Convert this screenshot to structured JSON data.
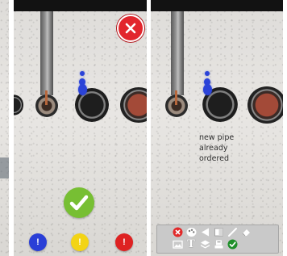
{
  "annotation": {
    "note_text": "new pipe\nalready\nordered"
  },
  "dots": [
    {
      "label": "!",
      "color": "#2a3fd7"
    },
    {
      "label": "!",
      "color": "#f3d415"
    },
    {
      "label": "!",
      "color": "#de2222"
    }
  ],
  "toolbar": {
    "text_tool_label": "T"
  },
  "colors": {
    "close_red": "#e2262d",
    "confirm_green": "#77bf33",
    "marker_blue": "#2b43d8",
    "toolbar_bg": "#c9c9c9"
  },
  "icons": {
    "close": "close-icon",
    "confirm": "checkmark-icon",
    "toolbar_row1": [
      "delete-icon",
      "color-palette-icon",
      "undo-arrow-icon",
      "eraser-block-icon",
      "pen-icon",
      "eraser-icon"
    ],
    "toolbar_row2": [
      "image-icon",
      "text-icon",
      "layers-icon",
      "stamp-icon",
      "accept-icon"
    ]
  }
}
